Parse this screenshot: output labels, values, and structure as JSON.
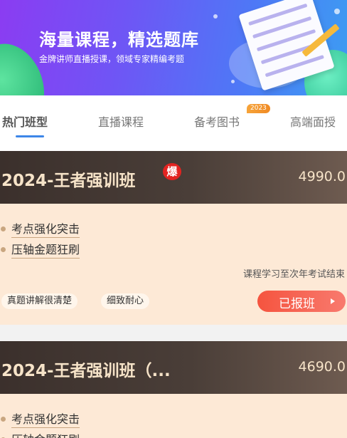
{
  "banner": {
    "title": "海量课程，精选题库",
    "subtitle": "金牌讲师直播授课，领域专家精编考题"
  },
  "tabs": [
    {
      "label": "热门班型",
      "active": true
    },
    {
      "label": "直播课程",
      "active": false
    },
    {
      "label": "备考图书",
      "active": false,
      "badge": "2023"
    },
    {
      "label": "高端面授",
      "active": false
    }
  ],
  "courses": [
    {
      "title": "2024-王者强训班",
      "hot_badge": "爆",
      "price": "4990.0",
      "features": [
        "考点强化突击",
        "压轴金题狂刷"
      ],
      "duration": "课程学习至次年考试结束",
      "tags": [
        "真题讲解很清楚",
        "细致耐心"
      ],
      "button": "已报班"
    },
    {
      "title": "2024-王者强训班（...",
      "price": "4690.0",
      "features": [
        "考点强化突击",
        "压轴金题狂刷"
      ]
    }
  ],
  "colors": {
    "accent_blue": "#3d86e8",
    "button_red": "#f5543f",
    "card_bg": "#fde9d6",
    "card_head": "#3b302c"
  }
}
